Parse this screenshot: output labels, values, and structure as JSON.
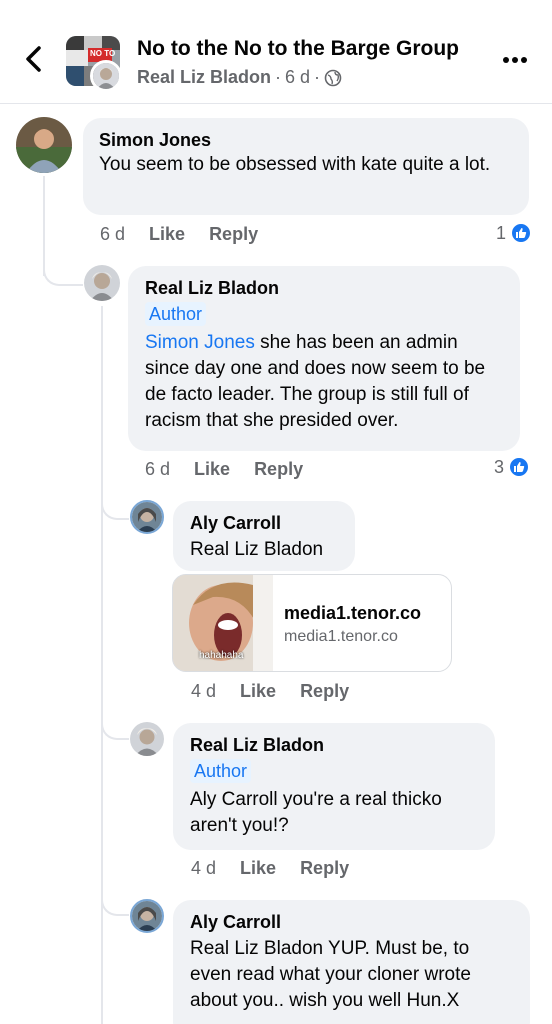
{
  "header": {
    "group_name": "No to the No to the Barge Group",
    "poster": "Real Liz Bladon",
    "time": "6 d",
    "separator": "·",
    "privacy_icon": "globe-icon",
    "back_icon": "chevron-left-icon",
    "more_icon": "more-dots-icon",
    "group_badge_text": "NO TO"
  },
  "comments": [
    {
      "name": "Simon Jones",
      "text": "You seem to be obsessed with kate quite a lot.",
      "time": "6 d",
      "like": "Like",
      "reply": "Reply",
      "reaction_count": "1"
    },
    {
      "name": "Real Liz Bladon",
      "badge": "Author",
      "mention": "Simon Jones",
      "text": " she has been an admin since day one and does now seem to be de facto leader. The group is still full of racism that she presided over.",
      "time": "6 d",
      "like": "Like",
      "reply": "Reply",
      "reaction_count": "3"
    },
    {
      "name": "Aly Carroll",
      "text": "Real Liz Bladon",
      "link_title": "media1.tenor.co",
      "link_domain": "media1.tenor.co",
      "gif_caption": "hahahaha",
      "time": "4 d",
      "like": "Like",
      "reply": "Reply"
    },
    {
      "name": "Real Liz Bladon",
      "badge": "Author",
      "text": "Aly Carroll you're a real thicko aren't you!?",
      "time": "4 d",
      "like": "Like",
      "reply": "Reply"
    },
    {
      "name": "Aly Carroll",
      "text": "Real Liz Bladon YUP.  Must be, to even read what your cloner wrote about you.. wish you well Hun.X"
    }
  ],
  "colors": {
    "accent": "#1877f2",
    "bubble": "#f0f2f5",
    "muted": "#65676b"
  }
}
